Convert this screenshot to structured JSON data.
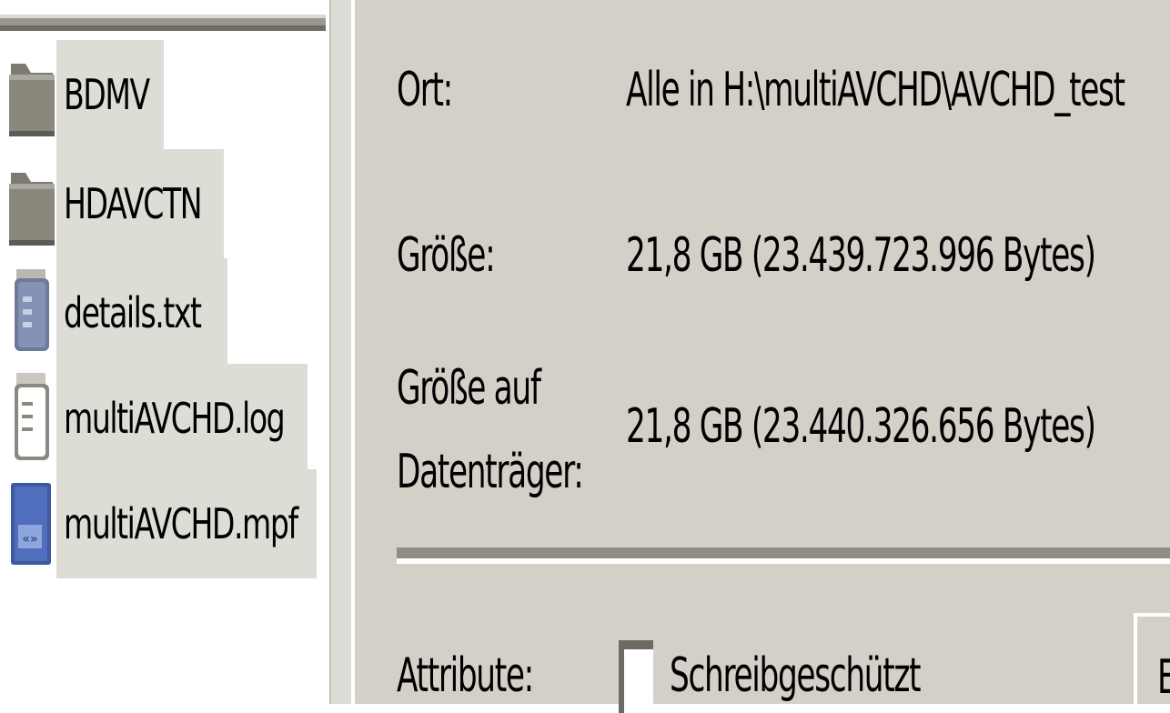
{
  "files": [
    {
      "name": "BDMV",
      "icon": "folder-icon"
    },
    {
      "name": "HDAVCTN",
      "icon": "folder-icon"
    },
    {
      "name": "details.txt",
      "icon": "text-file-icon"
    },
    {
      "name": "multiAVCHD.log",
      "icon": "notepad-file-icon"
    },
    {
      "name": "multiAVCHD.mpf",
      "icon": "project-file-icon"
    }
  ],
  "properties": {
    "location_label": "Ort:",
    "location_value": "Alle in H:\\multiAVCHD\\AVCHD_test",
    "size_label": "Größe:",
    "size_value": "21,8 GB (23.439.723.996 Bytes)",
    "disk_size_label_line1": "Größe auf",
    "disk_size_label_line2": "Datenträger:",
    "disk_size_value": "21,8 GB (23.440.326.656 Bytes)",
    "attributes_label": "Attribute:",
    "readonly_label": "Schreibgeschützt",
    "cut_off_letter": "E"
  },
  "colors": {
    "panel_background": "#d4d0c8",
    "selection_background": "#dddcd5",
    "folder": "#8a877d"
  }
}
